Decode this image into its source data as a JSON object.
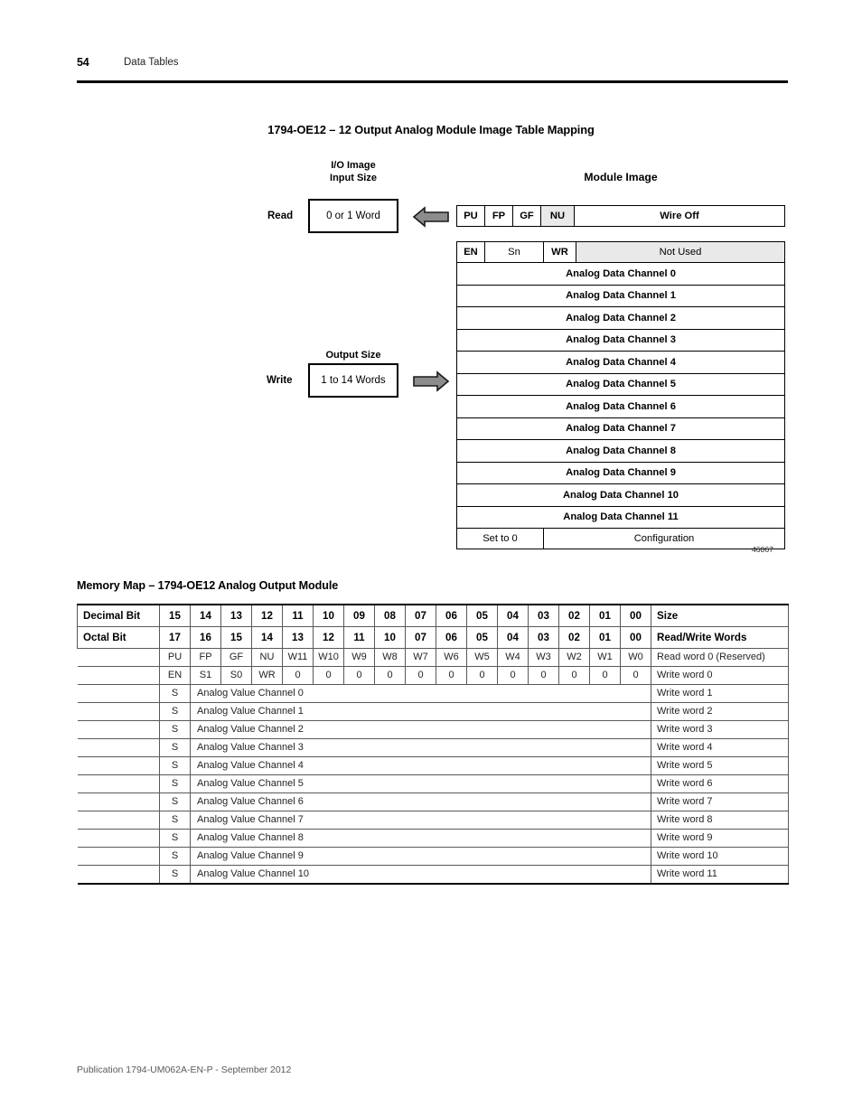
{
  "header": {
    "page_number": "54",
    "section": "Data Tables",
    "rule_color": "#000000"
  },
  "figure": {
    "title": "1794-OE12 – 12 Output Analog Module Image Table Mapping",
    "figure_number": "46067",
    "io_image_label_line1": "I/O Image",
    "io_image_label_line2": "Input Size",
    "module_image_label": "Module Image",
    "output_size_label": "Output Size",
    "read_label": "Read",
    "write_label": "Write",
    "read_size_value": "0 or 1 Word",
    "write_size_value": "1 to 14 Words",
    "arrow_color": "#8c8c8c",
    "shaded_cell_color": "#e9e9e9",
    "read_row": {
      "cells": [
        "PU",
        "FP",
        "GF",
        "NU"
      ],
      "shaded_cell": "NU",
      "description": "Wire Off"
    },
    "write_header_row": {
      "cells": [
        "EN",
        "Sn",
        "WR"
      ],
      "description": "Not Used"
    },
    "channels": [
      "Analog Data Channel 0",
      "Analog Data Channel 1",
      "Analog Data Channel 2",
      "Analog Data Channel 3",
      "Analog Data Channel 4",
      "Analog Data Channel 5",
      "Analog Data Channel 6",
      "Analog Data Channel 7",
      "Analog Data Channel 8",
      "Analog Data Channel 9",
      "Analog Data Channel 10",
      "Analog Data Channel 11"
    ],
    "footer_row": {
      "left": "Set to 0",
      "right": "Configuration"
    }
  },
  "memory_map": {
    "title": "Memory Map – 1794-OE12 Analog Output Module",
    "header_decimal": {
      "label": "Decimal Bit",
      "bits": [
        "15",
        "14",
        "13",
        "12",
        "11",
        "10",
        "09",
        "08",
        "07",
        "06",
        "05",
        "04",
        "03",
        "02",
        "01",
        "00"
      ],
      "size_label": "Size"
    },
    "header_octal": {
      "label": "Octal Bit",
      "bits": [
        "17",
        "16",
        "15",
        "14",
        "13",
        "12",
        "11",
        "10",
        "07",
        "06",
        "05",
        "04",
        "03",
        "02",
        "01",
        "00"
      ],
      "size_label": "Read/Write Words"
    },
    "read_word_row": {
      "bits": [
        "PU",
        "FP",
        "GF",
        "NU",
        "W11",
        "W10",
        "W9",
        "W8",
        "W7",
        "W6",
        "W5",
        "W4",
        "W3",
        "W2",
        "W1",
        "W0"
      ],
      "word": "Read word 0 (Reserved)"
    },
    "write_word_row": {
      "bits": [
        "EN",
        "S1",
        "S0",
        "WR",
        "0",
        "0",
        "0",
        "0",
        "0",
        "0",
        "0",
        "0",
        "0",
        "0",
        "0",
        "0"
      ],
      "word": "Write word 0"
    },
    "analog_rows": [
      {
        "sign": "S",
        "value": "Analog Value Channel 0",
        "word": "Write word 1"
      },
      {
        "sign": "S",
        "value": "Analog Value Channel 1",
        "word": "Write word 2"
      },
      {
        "sign": "S",
        "value": "Analog Value Channel 2",
        "word": "Write word 3"
      },
      {
        "sign": "S",
        "value": "Analog Value Channel 3",
        "word": "Write word 4"
      },
      {
        "sign": "S",
        "value": "Analog Value Channel 4",
        "word": "Write word 5"
      },
      {
        "sign": "S",
        "value": "Analog Value Channel 5",
        "word": "Write word 6"
      },
      {
        "sign": "S",
        "value": "Analog Value Channel 6",
        "word": "Write word 7"
      },
      {
        "sign": "S",
        "value": "Analog Value Channel 7",
        "word": "Write word 8"
      },
      {
        "sign": "S",
        "value": "Analog Value Channel 8",
        "word": "Write word 9"
      },
      {
        "sign": "S",
        "value": "Analog Value Channel 9",
        "word": "Write word 10"
      },
      {
        "sign": "S",
        "value": "Analog Value Channel 10",
        "word": "Write word 11"
      }
    ]
  },
  "footer": {
    "publication": "Publication 1794-UM062A-EN-P - September 2012"
  }
}
